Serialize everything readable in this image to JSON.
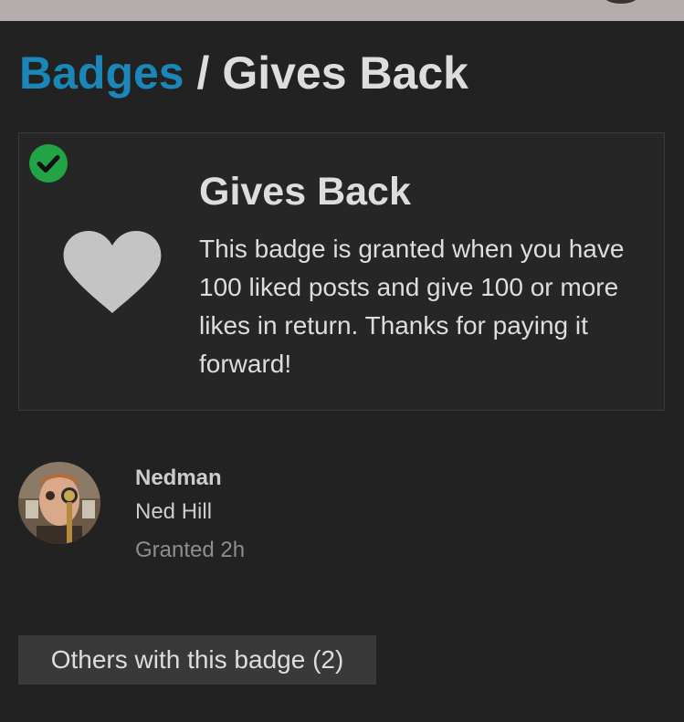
{
  "breadcrumb": {
    "parent_label": "Badges",
    "separator": "/",
    "current_label": "Gives Back"
  },
  "badge": {
    "title": "Gives Back",
    "description": "This badge is granted when you have 100 liked posts and give 100 or more likes in return. Thanks for paying it forward!",
    "icon": "heart-icon",
    "status_icon": "check-circle-icon",
    "colors": {
      "status_green": "#22a344",
      "heart": "#c4c4c4",
      "link": "#1a87b8"
    }
  },
  "grantee": {
    "username": "Nedman",
    "full_name": "Ned Hill",
    "granted": "Granted 2h"
  },
  "others_button": {
    "label": "Others with this badge (2)"
  }
}
